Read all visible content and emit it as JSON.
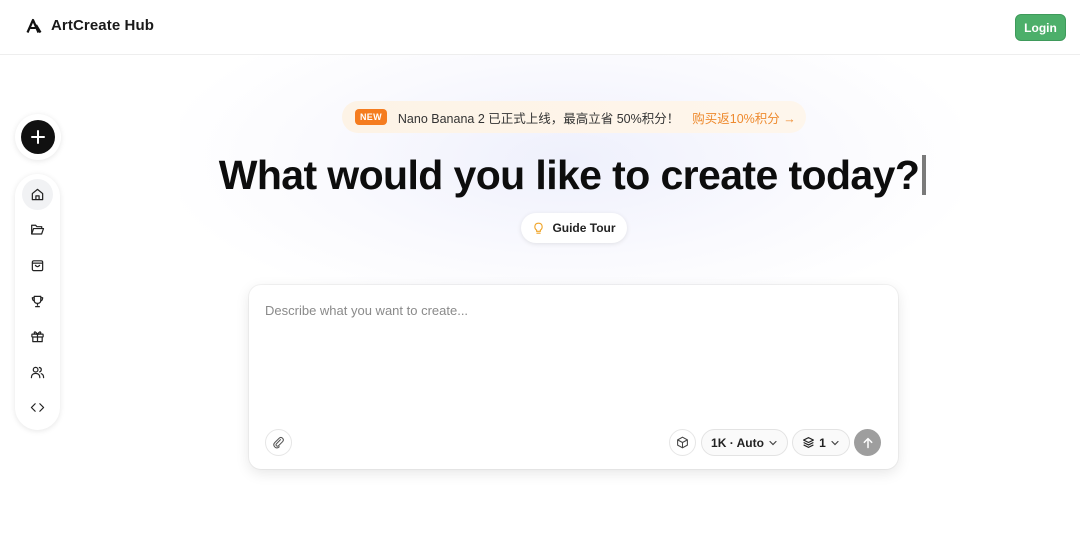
{
  "app": {
    "title": "ArtCreate Hub",
    "logo_icon": "brand-logo-icon"
  },
  "header": {
    "login_label": "Login"
  },
  "sidebar": {
    "create_icon": "plus-icon",
    "items": [
      {
        "name": "home",
        "icon": "home-icon",
        "active": true
      },
      {
        "name": "folder",
        "icon": "folder-open-icon",
        "active": false
      },
      {
        "name": "shop",
        "icon": "shopping-bag-icon",
        "active": false
      },
      {
        "name": "trophy",
        "icon": "trophy-icon",
        "active": false
      },
      {
        "name": "gift",
        "icon": "gift-icon",
        "active": false
      },
      {
        "name": "users",
        "icon": "users-icon",
        "active": false
      },
      {
        "name": "code",
        "icon": "code-icon",
        "active": false
      }
    ]
  },
  "banner": {
    "badge": "NEW",
    "text": "Nano Banana 2 已正式上线，最高立省 50%积分！",
    "link": "购买返10%积分 →"
  },
  "main": {
    "headline": "What would you like to create today?",
    "guide_tour_label": "Guide Tour"
  },
  "prompt": {
    "placeholder": "Describe what you want to create...",
    "value": "",
    "resolution_label": "1K · Auto",
    "count_label": "1"
  },
  "colors": {
    "login_green": "#4caf6a",
    "badge_orange": "#f57c1f",
    "banner_link": "#ee8a2e",
    "send_gray": "#9e9e9e"
  }
}
